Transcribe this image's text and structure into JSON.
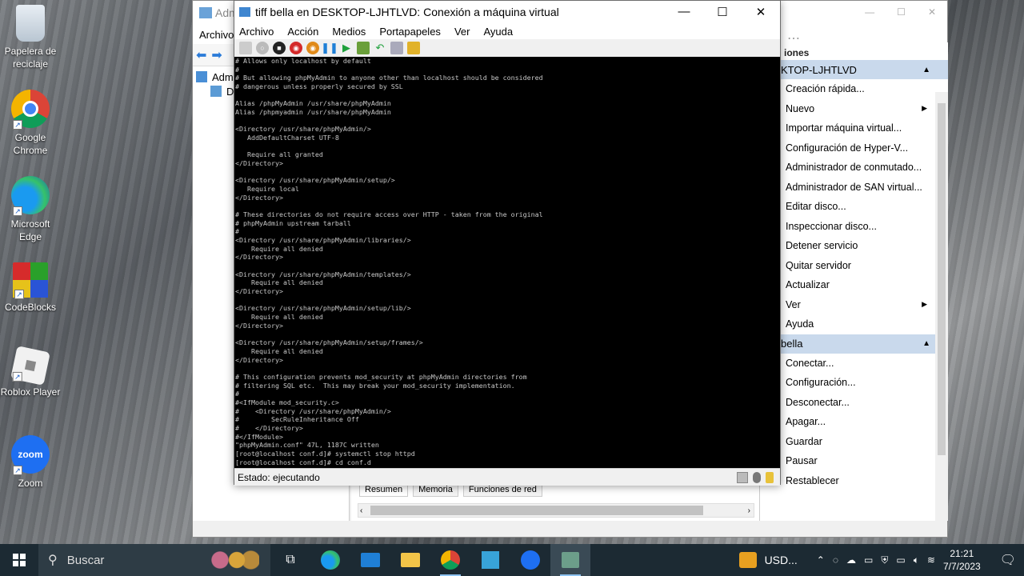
{
  "desktop": {
    "icons": [
      {
        "label": "Papelera de reciclaje",
        "icon": "recycle-bin-icon"
      },
      {
        "label": "Google Chrome",
        "icon": "chrome-icon"
      },
      {
        "label": "Microsoft Edge",
        "icon": "edge-icon"
      },
      {
        "label": "CodeBlocks",
        "icon": "codeblocks-icon"
      },
      {
        "label": "Roblox Player",
        "icon": "roblox-icon"
      },
      {
        "label": "Zoom",
        "icon": "zoom-icon"
      }
    ]
  },
  "manager": {
    "title_fragment": "Adm",
    "menu_archivo": "Archivo",
    "tree_node_1": "Admi",
    "tree_node_2": "D",
    "actions_header": "iones",
    "section_host": "KTOP-LJHTLVD",
    "host_actions": [
      {
        "label": "Creación rápida...",
        "arrow": false
      },
      {
        "label": "Nuevo",
        "arrow": true
      },
      {
        "label": "Importar máquina virtual...",
        "arrow": false
      },
      {
        "label": "Configuración de Hyper-V...",
        "arrow": false
      },
      {
        "label": "Administrador de conmutado...",
        "arrow": false
      },
      {
        "label": "Administrador de SAN virtual...",
        "arrow": false
      },
      {
        "label": "Editar disco...",
        "arrow": false
      },
      {
        "label": "Inspeccionar disco...",
        "arrow": false
      },
      {
        "label": "Detener servicio",
        "arrow": false
      },
      {
        "label": "Quitar servidor",
        "arrow": false
      },
      {
        "label": "Actualizar",
        "arrow": false
      },
      {
        "label": "Ver",
        "arrow": true
      },
      {
        "label": "Ayuda",
        "arrow": false
      }
    ],
    "section_vm": "bella",
    "vm_actions": [
      {
        "label": "Conectar...",
        "icon": ""
      },
      {
        "label": "Configuración...",
        "icon": ""
      },
      {
        "label": "Desconectar...",
        "icon": ""
      },
      {
        "label": "Apagar...",
        "icon": ""
      },
      {
        "label": "Guardar",
        "icon": ""
      },
      {
        "label": "Pausar",
        "icon": "pause-icon"
      },
      {
        "label": "Restablecer",
        "icon": "reset-icon"
      }
    ],
    "tabs": [
      "Resumen",
      "Memoria",
      "Funciones de red"
    ]
  },
  "vm": {
    "title": "tiff bella en DESKTOP-LJHTLVD: Conexión a máquina virtual",
    "menu": [
      "Archivo",
      "Acción",
      "Medios",
      "Portapapeles",
      "Ver",
      "Ayuda"
    ],
    "status": "Estado: ejecutando",
    "console_lines": [
      "# Allows only localhost by default",
      "#",
      "# But allowing phpMyAdmin to anyone other than localhost should be considered",
      "# dangerous unless properly secured by SSL",
      "",
      "Alias /phpMyAdmin /usr/share/phpMyAdmin",
      "Alias /phpmyadmin /usr/share/phpMyAdmin",
      "",
      "<Directory /usr/share/phpMyAdmin/>",
      "   AddDefaultCharset UTF-8",
      "",
      "   Require all granted",
      "</Directory>",
      "",
      "<Directory /usr/share/phpMyAdmin/setup/>",
      "   Require local",
      "</Directory>",
      "",
      "# These directories do not require access over HTTP - taken from the original",
      "# phpMyAdmin upstream tarball",
      "#",
      "<Directory /usr/share/phpMyAdmin/libraries/>",
      "    Require all denied",
      "</Directory>",
      "",
      "<Directory /usr/share/phpMyAdmin/templates/>",
      "    Require all denied",
      "</Directory>",
      "",
      "<Directory /usr/share/phpMyAdmin/setup/lib/>",
      "    Require all denied",
      "</Directory>",
      "",
      "<Directory /usr/share/phpMyAdmin/setup/frames/>",
      "    Require all denied",
      "</Directory>",
      "",
      "# This configuration prevents mod_security at phpMyAdmin directories from",
      "# filtering SQL etc.  This may break your mod_security implementation.",
      "#",
      "#<IfModule mod_security.c>",
      "#    <Directory /usr/share/phpMyAdmin/>",
      "#        SecRuleInheritance Off",
      "#    </Directory>",
      "#</IfModule>",
      "\"phpMyAdmin.conf\" 47L, 1187C written",
      "[root@localhost conf.d]# systemctl stop httpd",
      "[root@localhost conf.d]# cd conf.d"
    ]
  },
  "taskbar": {
    "search_label": "Buscar",
    "tray_label": "USD...",
    "time": "21:21",
    "date": "7/7/2023"
  },
  "colors": {
    "section_header_bg": "#c9d9ec",
    "taskbar_bg": "#1c2a33",
    "console_bg": "#000000",
    "console_fg": "#c8c8c8"
  }
}
